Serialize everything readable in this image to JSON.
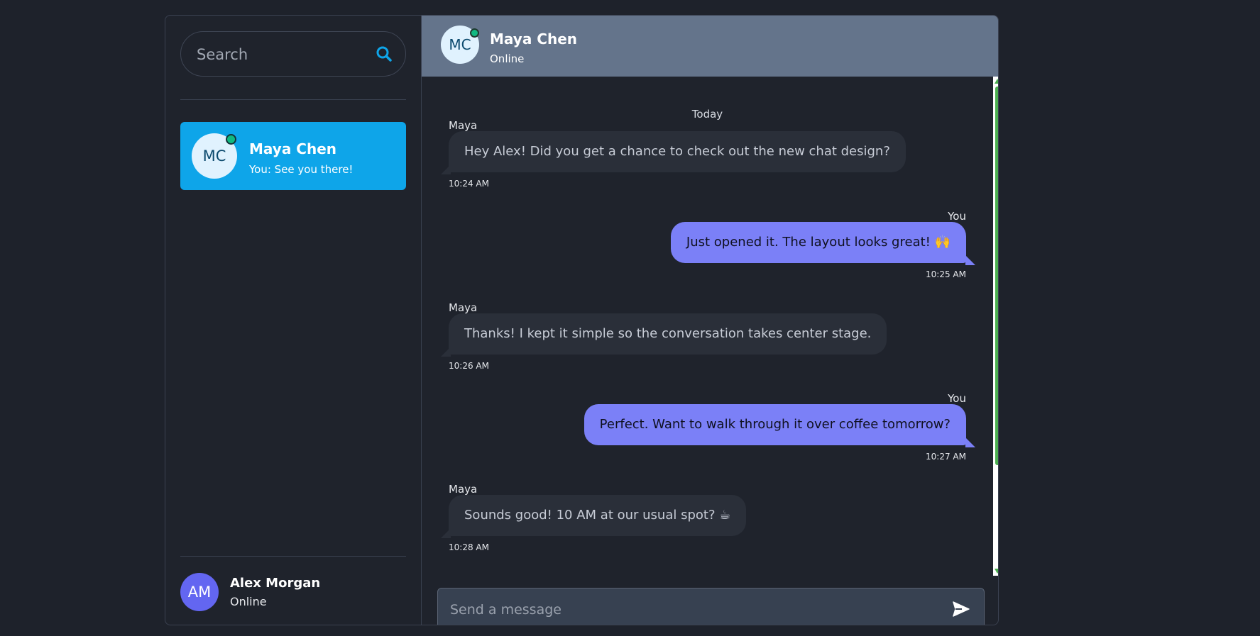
{
  "search": {
    "placeholder": "Search",
    "icon": "search-icon"
  },
  "contacts": [
    {
      "initials": "MC",
      "name": "Maya Chen",
      "preview": "You: See you there!",
      "online": true
    }
  ],
  "current_user": {
    "initials": "AM",
    "name": "Alex Morgan",
    "status": "Online"
  },
  "chat": {
    "header": {
      "initials": "MC",
      "name": "Maya Chen",
      "status": "Online"
    },
    "date_separator": "Today",
    "messages": [
      {
        "direction": "in",
        "sender": "Maya",
        "text": "Hey Alex! Did you get a chance to check out the new chat design?",
        "time": "10:24 AM"
      },
      {
        "direction": "out",
        "sender": "You",
        "text": "Just opened it. The layout looks great! 🙌",
        "time": "10:25 AM"
      },
      {
        "direction": "in",
        "sender": "Maya",
        "text": "Thanks! I kept it simple so the conversation takes center stage.",
        "time": "10:26 AM"
      },
      {
        "direction": "out",
        "sender": "You",
        "text": "Perfect. Want to walk through it over coffee tomorrow?",
        "time": "10:27 AM"
      },
      {
        "direction": "in",
        "sender": "Maya",
        "text": "Sounds good! 10 AM at our usual spot? ☕",
        "time": "10:28 AM"
      }
    ]
  },
  "composer": {
    "placeholder": "Send a message",
    "send_icon": "send-icon"
  },
  "colors": {
    "accent": "#0ea5e9",
    "outgoing_bubble": "#7b80f7",
    "incoming_bubble": "#2a2f39",
    "online": "#10b981",
    "header": "#64748b",
    "scrollbar": "#4caf50"
  }
}
